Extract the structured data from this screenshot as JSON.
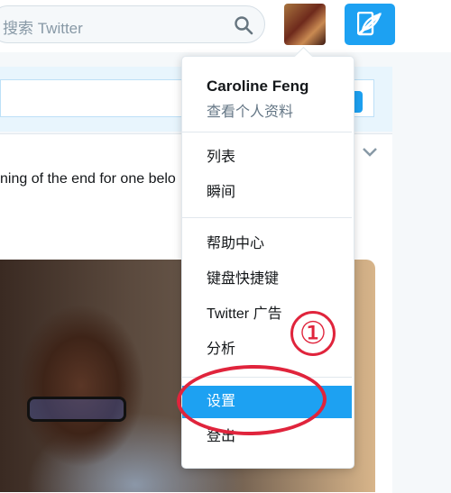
{
  "search": {
    "placeholder": "搜索 Twitter"
  },
  "feed": {
    "tweet_text": "ning of the end for one belo"
  },
  "profile": {
    "name": "Caroline Feng",
    "view_profile": "查看个人资料"
  },
  "menu": {
    "items": [
      {
        "label": "列表"
      },
      {
        "label": "瞬间"
      },
      {
        "label": "帮助中心"
      },
      {
        "label": "键盘快捷键"
      },
      {
        "label": "Twitter 广告"
      },
      {
        "label": "分析"
      },
      {
        "label": "设置"
      },
      {
        "label": "登出"
      }
    ]
  },
  "annotation": {
    "marker": "①"
  },
  "colors": {
    "accent": "#1da1f2",
    "annotation": "#e0243c",
    "text": "#14171a",
    "muted": "#657786"
  }
}
